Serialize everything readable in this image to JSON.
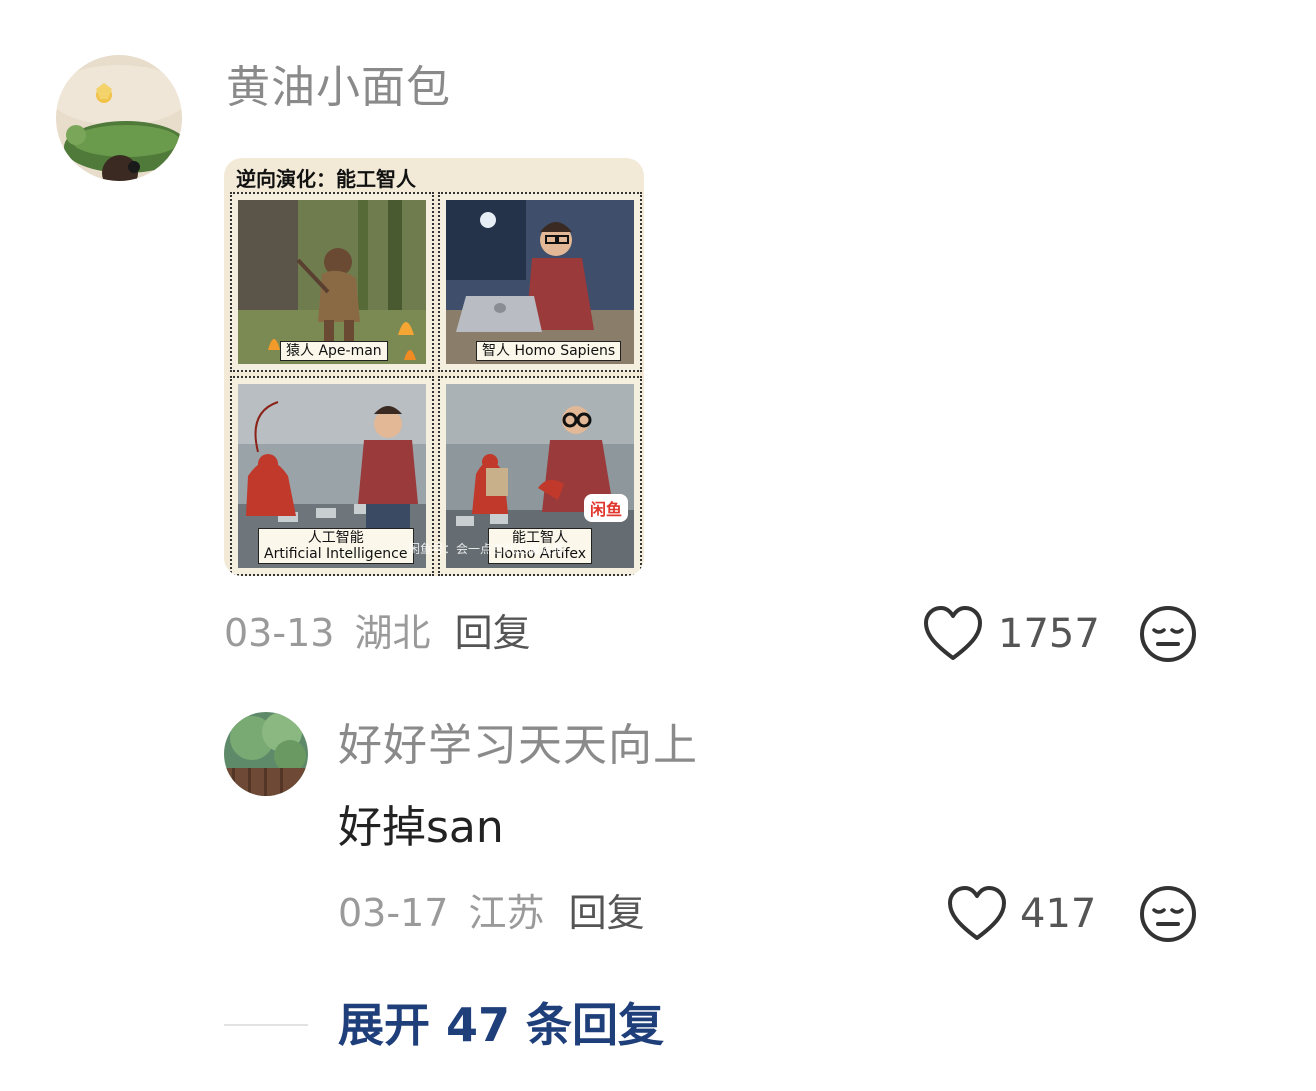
{
  "comment": {
    "username": "黄油小面包",
    "image": {
      "title": "逆向演化：能工智人",
      "panels": [
        {
          "caption": "猿人 Ape-man"
        },
        {
          "caption": "智人 Homo Sapiens"
        },
        {
          "caption_line1": "人工智能",
          "caption_line2": "Artificial Intelligence"
        },
        {
          "caption_line1": "能工智人",
          "caption_line2": "Homo Artifex"
        }
      ],
      "watermark": "闲鱼号：会一点古代的魔法师",
      "badge": "闲鱼"
    },
    "date": "03-13",
    "location": "湖北",
    "reply_label": "回复",
    "likes": "1757"
  },
  "reply": {
    "username": "好好学习天天向上",
    "text": "好掉san",
    "date": "03-17",
    "location": "江苏",
    "reply_label": "回复",
    "likes": "417"
  },
  "expand": {
    "label": "展开 47 条回复"
  }
}
